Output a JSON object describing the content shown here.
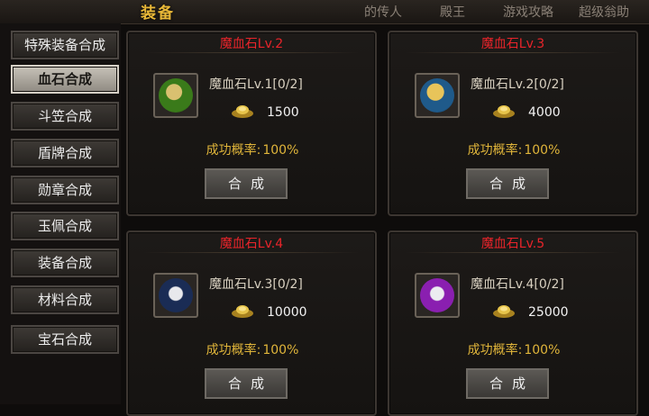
{
  "header": {
    "title": "装备",
    "tabs": [
      "的传人",
      "殿王",
      "游戏攻略",
      "超级翁助"
    ]
  },
  "sidebar": {
    "items": [
      {
        "label": "特殊装备合成"
      },
      {
        "label": "血石合成",
        "active": true
      },
      {
        "label": "斗笠合成"
      },
      {
        "label": "盾牌合成"
      },
      {
        "label": "勋章合成"
      },
      {
        "label": "玉佩合成"
      },
      {
        "label": "装备合成"
      },
      {
        "label": "材料合成"
      },
      {
        "label": "宝石合成"
      }
    ]
  },
  "recipes": [
    {
      "title": "魔血石Lv.2",
      "material": "魔血石Lv.1[0/2]",
      "cost": "1500",
      "rate_label": "成功概率:",
      "rate": "100%",
      "button": "合成",
      "icon": "green-gem-icon",
      "color": "#3a7a1a"
    },
    {
      "title": "魔血石Lv.3",
      "material": "魔血石Lv.2[0/2]",
      "cost": "4000",
      "rate_label": "成功概率:",
      "rate": "100%",
      "button": "合成",
      "icon": "blue-gem-icon",
      "color": "#1f5a8a"
    },
    {
      "title": "魔血石Lv.4",
      "material": "魔血石Lv.3[0/2]",
      "cost": "10000",
      "rate_label": "成功概率:",
      "rate": "100%",
      "button": "合成",
      "icon": "dark-blue-tiger-gem-icon",
      "color": "#1a2c55"
    },
    {
      "title": "魔血石Lv.5",
      "material": "魔血石Lv.4[0/2]",
      "cost": "25000",
      "rate_label": "成功概率:",
      "rate": "100%",
      "button": "合成",
      "icon": "purple-tiger-gem-icon",
      "color": "#6a1a8a"
    }
  ]
}
